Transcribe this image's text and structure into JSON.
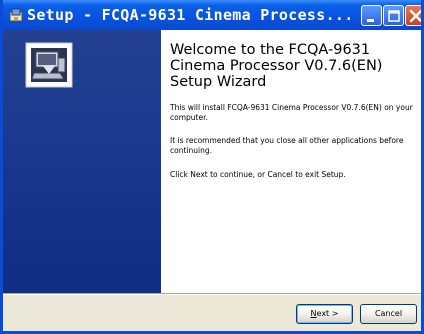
{
  "window": {
    "title": "Setup - FCQA-9631 Cinema Process..."
  },
  "content": {
    "heading": "Welcome to the FCQA-9631 Cinema Processor V0.7.6(EN) Setup Wizard",
    "paragraph1": "This will install FCQA-9631 Cinema Processor V0.7.6(EN) on your computer.",
    "paragraph2": "It is recommended that you close all other applications before continuing.",
    "paragraph3": "Click Next to continue, or Cancel to exit Setup."
  },
  "buttons": {
    "next_mnemonic": "N",
    "next_rest": "ext >",
    "cancel": "Cancel"
  },
  "colors": {
    "titlebar": "#0753e0",
    "sidebar": "#1b3a8f",
    "dialog_face": "#ece9d8",
    "close_button": "#c4441d"
  },
  "icons": {
    "title": "setup-app-icon",
    "sidebar": "computer-install-icon",
    "minimize": "minimize-icon",
    "maximize": "maximize-icon",
    "close": "close-icon"
  }
}
